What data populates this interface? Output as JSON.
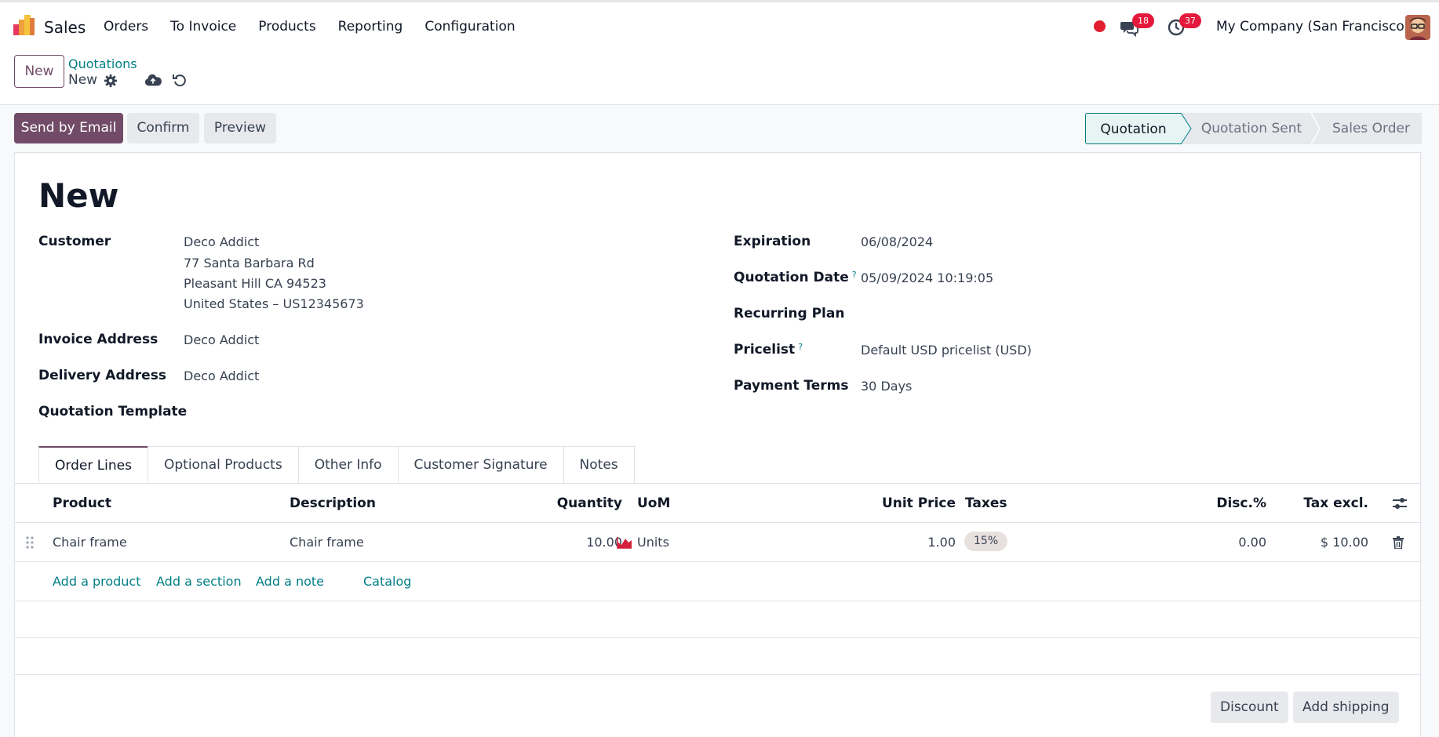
{
  "nav": {
    "app_name": "Sales",
    "menu": [
      "Orders",
      "To Invoice",
      "Products",
      "Reporting",
      "Configuration"
    ],
    "messages_count": "18",
    "activities_count": "37",
    "company": "My Company (San Francisco)",
    "icons": [
      "app-logo-icon",
      "recording-dot-icon",
      "chat-icon",
      "clock-icon",
      "user-avatar"
    ]
  },
  "control": {
    "new_button": "New",
    "breadcrumb_parent": "Quotations",
    "breadcrumb_current": "New"
  },
  "actions": {
    "send_email": "Send by Email",
    "confirm": "Confirm",
    "preview": "Preview"
  },
  "status": {
    "stages": [
      "Quotation",
      "Quotation Sent",
      "Sales Order"
    ],
    "active": "Quotation"
  },
  "form": {
    "title": "New",
    "customer_label": "Customer",
    "customer_name": "Deco Addict",
    "customer_address": [
      "77 Santa Barbara Rd",
      "Pleasant Hill CA 94523",
      "United States – US12345673"
    ],
    "invoice_address_label": "Invoice Address",
    "invoice_address": "Deco Addict",
    "delivery_address_label": "Delivery Address",
    "delivery_address": "Deco Addict",
    "quotation_template_label": "Quotation Template",
    "expiration_label": "Expiration",
    "expiration": "06/08/2024",
    "quotation_date_label": "Quotation Date",
    "quotation_date": "05/09/2024 10:19:05",
    "recurring_plan_label": "Recurring Plan",
    "pricelist_label": "Pricelist",
    "pricelist": "Default USD pricelist (USD)",
    "payment_terms_label": "Payment Terms",
    "payment_terms": "30 Days",
    "help_mark": "?"
  },
  "tabs": [
    "Order Lines",
    "Optional Products",
    "Other Info",
    "Customer Signature",
    "Notes"
  ],
  "table": {
    "headers": {
      "product": "Product",
      "description": "Description",
      "quantity": "Quantity",
      "uom": "UoM",
      "unit_price": "Unit Price",
      "taxes": "Taxes",
      "discount": "Disc.%",
      "tax_excl": "Tax excl."
    },
    "rows": [
      {
        "product": "Chair frame",
        "description": "Chair frame",
        "quantity": "10.00",
        "uom": "Units",
        "unit_price": "1.00",
        "taxes": "15%",
        "discount": "0.00",
        "subtotal": "$ 10.00"
      }
    ],
    "add_product": "Add a product",
    "add_section": "Add a section",
    "add_note": "Add a note",
    "catalog": "Catalog"
  },
  "footer": {
    "discount": "Discount",
    "add_shipping": "Add shipping"
  },
  "colors": {
    "primary": "#714b67",
    "link": "#017e84",
    "badge": "#e4193c"
  }
}
